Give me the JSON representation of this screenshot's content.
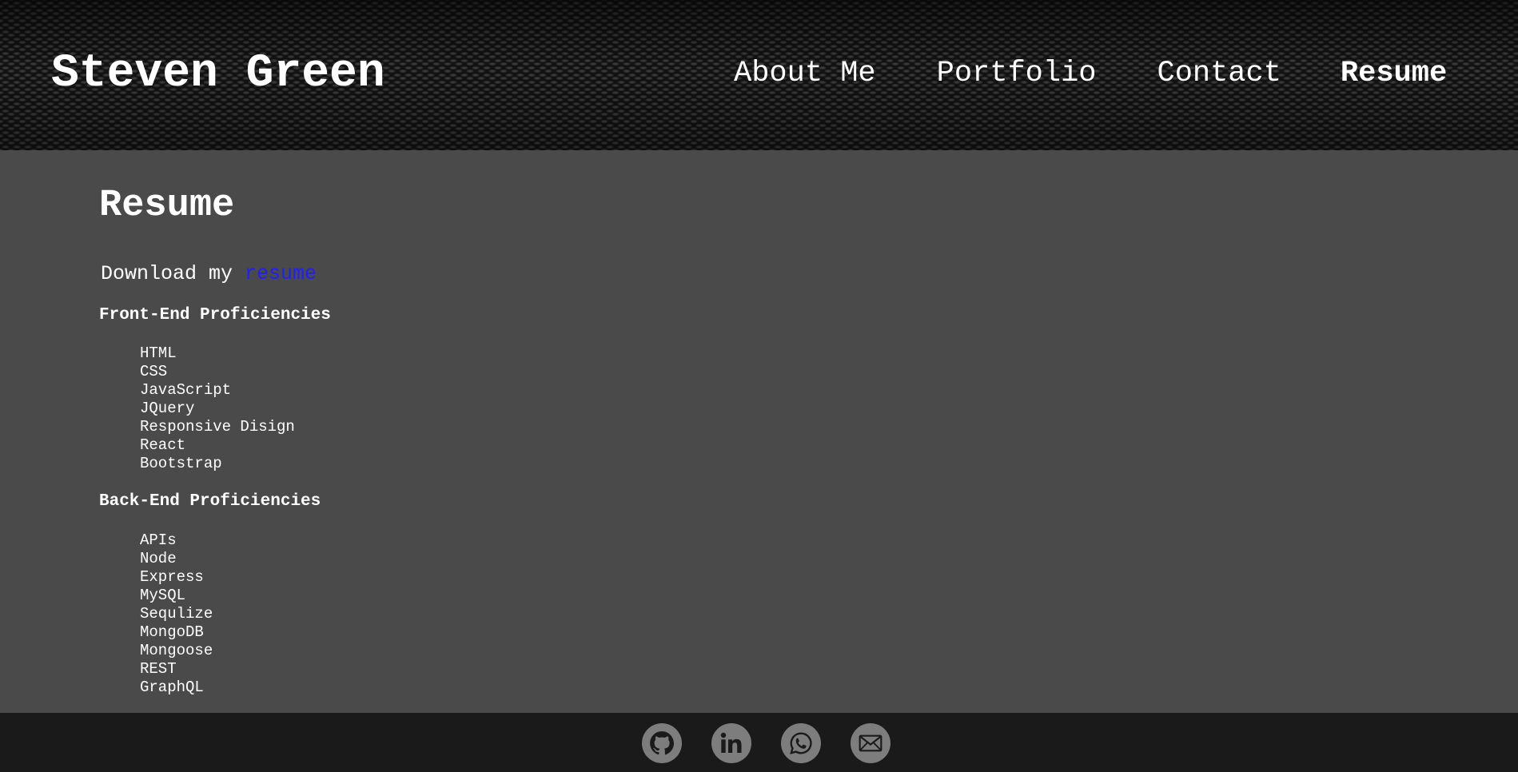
{
  "header": {
    "brand": "Steven Green",
    "nav": [
      {
        "label": "About Me"
      },
      {
        "label": "Portfolio"
      },
      {
        "label": "Contact"
      },
      {
        "label": "Resume",
        "active": true
      }
    ]
  },
  "main": {
    "title": "Resume",
    "download_prefix": "Download my ",
    "download_link": "resume",
    "front_end": {
      "heading": "Front-End Proficiencies",
      "items": [
        "HTML",
        "CSS",
        "JavaScript",
        "JQuery",
        "Responsive Disign",
        "React",
        "Bootstrap"
      ]
    },
    "back_end": {
      "heading": "Back-End Proficiencies",
      "items": [
        "APIs",
        "Node",
        "Express",
        "MySQL",
        "Sequlize",
        "MongoDB",
        "Mongoose",
        "REST",
        "GraphQL"
      ]
    }
  },
  "footer": {
    "icons": [
      "github-icon",
      "linkedin-icon",
      "whatsapp-icon",
      "email-icon"
    ]
  },
  "colors": {
    "header_bg": "#131313",
    "main_bg": "#4a4a4a",
    "footer_bg": "#1a1a1a",
    "link": "#1e1eff",
    "social_bg": "#7d7d7d"
  }
}
